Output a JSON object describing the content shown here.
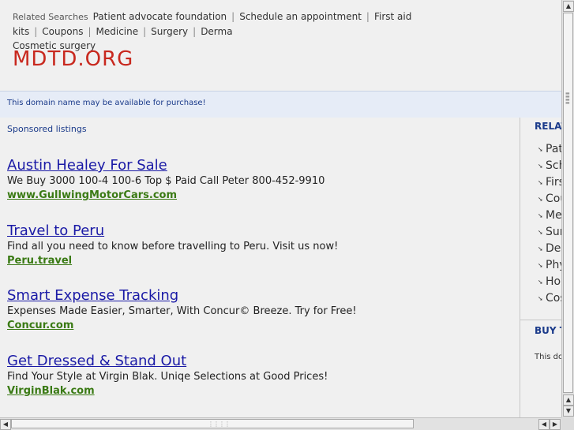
{
  "related_searches": {
    "label": "Related Searches",
    "items": [
      "Patient advocate foundation",
      "Schedule an appointment",
      "First aid kits",
      "Coupons",
      "Medicine",
      "Surgery",
      "Derma",
      "Cosmetic surgery"
    ]
  },
  "site": {
    "title": "MDTD.ORG"
  },
  "banner": {
    "text": "This domain name may be available for purchase!"
  },
  "sponsored": {
    "label": "Sponsored listings"
  },
  "ads": [
    {
      "title": "Austin Healey For Sale",
      "desc": "We Buy 3000 100-4 100-6 Top $ Paid Call Peter 800-452-9910",
      "url": "www.GullwingMotorCars.com"
    },
    {
      "title": "Travel to Peru",
      "desc": "Find all you need to know before travelling to Peru. Visit us now!",
      "url": "Peru.travel"
    },
    {
      "title": "Smart Expense Tracking",
      "desc": "Expenses Made Easier, Smarter, With Concur© Breeze. Try for Free!",
      "url": "Concur.com"
    },
    {
      "title": "Get Dressed & Stand Out",
      "desc": "Find Your Style at Virgin Blak. Uniqe Selections at Good Prices!",
      "url": "VirginBlak.com"
    }
  ],
  "right_column": {
    "related_heading": "RELAT",
    "items": [
      "Pat",
      "Sch",
      "Firs",
      "Cou",
      "Mec",
      "Sur",
      "Der",
      "Phy",
      "Hor",
      "Cos"
    ],
    "buy_heading": "BUY T",
    "buy_text": "This dor"
  },
  "icons": {
    "bullet": "arrow-bullet-icon",
    "scroll_up": "arrow-up-icon",
    "scroll_down": "arrow-down-icon",
    "scroll_left": "arrow-left-icon",
    "scroll_right": "arrow-right-icon"
  },
  "colors": {
    "title_red": "#c8281e",
    "link_blue": "#1a1aa6",
    "url_green": "#3a7a14",
    "banner_bg": "#e6ecf7"
  }
}
